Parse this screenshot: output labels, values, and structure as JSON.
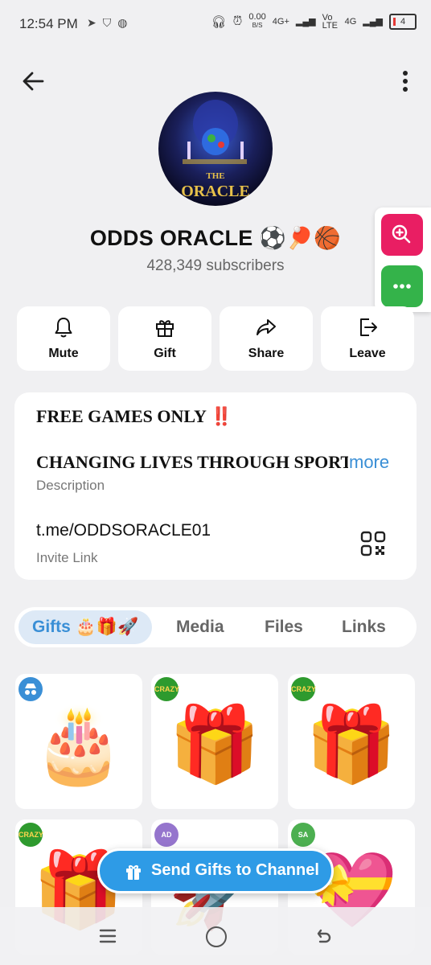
{
  "status": {
    "time": "12:54 PM",
    "net_speed": "0.00",
    "net_unit": "B/S",
    "sig1": "4G+",
    "volte": "Vo LTE",
    "sig2": "4G",
    "battery": "4"
  },
  "channel": {
    "name": "ODDS ORACLE ⚽🏓🏀",
    "subscribers": "428,349 subscribers"
  },
  "actions": [
    {
      "label": "Mute",
      "icon": "bell-icon"
    },
    {
      "label": "Gift",
      "icon": "gift-icon"
    },
    {
      "label": "Share",
      "icon": "share-icon"
    },
    {
      "label": "Leave",
      "icon": "leave-icon"
    }
  ],
  "info": {
    "line1": "FREE GAMES ONLY ",
    "line1_emoji": "‼️",
    "line2": "CHANGING LIVES THROUGH SPORTS",
    "more": "more",
    "description_label": "Description",
    "invite_link": "t.me/ODDSORACLE01",
    "invite_label": "Invite Link"
  },
  "tabs": [
    {
      "label": "Gifts 🎂🎁🚀",
      "active": true
    },
    {
      "label": "Media",
      "active": false
    },
    {
      "label": "Files",
      "active": false
    },
    {
      "label": "Links",
      "active": false
    }
  ],
  "gifts": [
    {
      "emoji": "🎂",
      "badge": "",
      "badge_color": "#3a8fd6"
    },
    {
      "emoji": "🎁",
      "badge": "CRAZY",
      "badge_color": "#2e9a2e"
    },
    {
      "emoji": "🎁",
      "badge": "CRAZY",
      "badge_color": "#2e9a2e"
    },
    {
      "emoji": "🎁",
      "badge": "CRAZY",
      "badge_color": "#2e9a2e"
    },
    {
      "emoji": "🚀",
      "badge": "AD",
      "badge_color": "#9575cd"
    },
    {
      "emoji": "💝",
      "badge": "SA",
      "badge_color": "#4caf50"
    }
  ],
  "send_button": "Send Gifts to Channel",
  "colors": {
    "accent": "#3a8fd6",
    "fab_zoom": "#e91e63",
    "fab_more": "#34b34a"
  }
}
